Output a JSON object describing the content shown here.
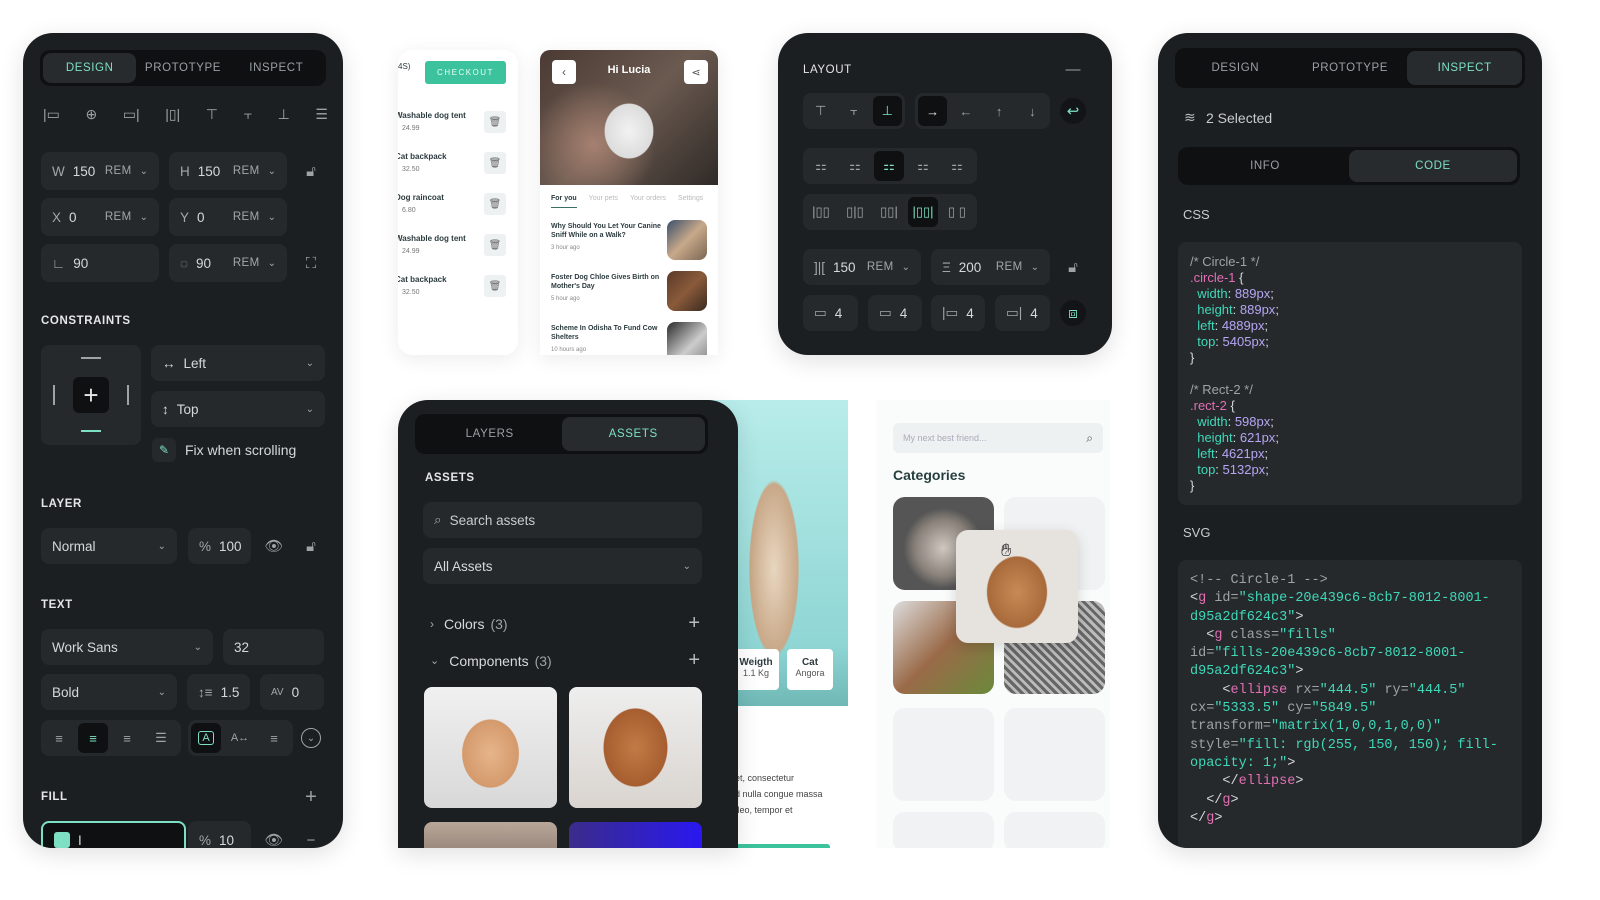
{
  "accent": "#7ee0c3",
  "design_panel": {
    "tabs": [
      "DESIGN",
      "PROTOTYPE",
      "INSPECT"
    ],
    "active_tab": "DESIGN",
    "align_icons": [
      "align-left-icon",
      "align-h-center-icon",
      "align-right-icon",
      "distribute-h-icon",
      "align-top-icon",
      "align-v-center-icon",
      "align-bottom-icon",
      "distribute-v-icon"
    ],
    "w": {
      "label": "W",
      "value": "150",
      "unit": "REM"
    },
    "h": {
      "label": "H",
      "value": "150",
      "unit": "REM"
    },
    "x": {
      "label": "X",
      "value": "0",
      "unit": "REM"
    },
    "y": {
      "label": "Y",
      "value": "0",
      "unit": "REM"
    },
    "rotation": {
      "value": "90"
    },
    "radius": {
      "value": "90",
      "unit": "REM"
    },
    "constraints": {
      "title": "CONSTRAINTS",
      "horizontal": "Left",
      "vertical": "Top",
      "fix_label": "Fix when scrolling"
    },
    "layer": {
      "title": "LAYER",
      "blend": "Normal",
      "opacity_sign": "%",
      "opacity": "100"
    },
    "text": {
      "title": "TEXT",
      "font": "Work Sans",
      "size": "32",
      "weight": "Bold",
      "line_height": "1.5",
      "letter_spacing": "0"
    },
    "fill": {
      "title": "FILL",
      "value": "I",
      "opacity_sign": "%",
      "opacity": "10",
      "swatch": "#7ee0c3"
    }
  },
  "cart_mock": {
    "checkout": "CHECKOUT",
    "header_fragment": "4S)",
    "items": [
      {
        "name": "Washable dog tent",
        "price": "24.99"
      },
      {
        "name": "Cat backpack",
        "price": "32.50"
      },
      {
        "name": "Dog raincoat",
        "price": "6.80"
      },
      {
        "name": "Washable dog tent",
        "price": "24.99"
      },
      {
        "name": "Cat backpack",
        "price": "32.50"
      }
    ]
  },
  "feed_mock": {
    "greeting": "Hi Lucia",
    "tabs": [
      "For you",
      "Your pets",
      "Your orders",
      "Settings"
    ],
    "articles": [
      {
        "title": "Why Should You Let Your Canine Sniff While on a Walk?",
        "time": "3 hour ago"
      },
      {
        "title": "Foster Dog Chloe Gives Birth on Mother's Day",
        "time": "5 hour ago"
      },
      {
        "title": "Scheme In Odisha To Fund Cow Shelters",
        "time": "10 hours ago"
      }
    ]
  },
  "layout_panel": {
    "title": "LAYOUT",
    "gap_h": {
      "value": "150",
      "unit": "REM"
    },
    "gap_v": {
      "value": "200",
      "unit": "REM"
    },
    "padding": [
      "4",
      "4",
      "4",
      "4"
    ]
  },
  "inspect_panel": {
    "tabs": [
      "DESIGN",
      "PROTOTYPE",
      "INSPECT"
    ],
    "active_tab": "INSPECT",
    "selected": "2 Selected",
    "subtabs": [
      "INFO",
      "CODE"
    ],
    "active_subtab": "CODE",
    "css_label": "CSS",
    "svg_label": "SVG",
    "css_lines": [
      [
        [
          "/* Circle-1 */",
          "com"
        ]
      ],
      [
        [
          ".circle-1",
          "sel"
        ],
        [
          " {",
          "p"
        ]
      ],
      [
        [
          "  width",
          "prop"
        ],
        [
          ": ",
          "p"
        ],
        [
          "889px",
          "val"
        ],
        [
          ";",
          "p"
        ]
      ],
      [
        [
          "  height",
          "prop"
        ],
        [
          ": ",
          "p"
        ],
        [
          "889px",
          "val"
        ],
        [
          ";",
          "p"
        ]
      ],
      [
        [
          "  left",
          "prop"
        ],
        [
          ": ",
          "p"
        ],
        [
          "4889px",
          "val"
        ],
        [
          ";",
          "p"
        ]
      ],
      [
        [
          "  top",
          "prop"
        ],
        [
          ": ",
          "p"
        ],
        [
          "5405px",
          "val"
        ],
        [
          ";",
          "p"
        ]
      ],
      [
        [
          "}",
          "p"
        ]
      ],
      [
        [
          "",
          "p"
        ]
      ],
      [
        [
          "/* Rect-2 */",
          "com"
        ]
      ],
      [
        [
          ".rect-2",
          "sel"
        ],
        [
          " {",
          "p"
        ]
      ],
      [
        [
          "  width",
          "prop"
        ],
        [
          ": ",
          "p"
        ],
        [
          "598px",
          "val"
        ],
        [
          ";",
          "p"
        ]
      ],
      [
        [
          "  height",
          "prop"
        ],
        [
          ": ",
          "p"
        ],
        [
          "621px",
          "val"
        ],
        [
          ";",
          "p"
        ]
      ],
      [
        [
          "  left",
          "prop"
        ],
        [
          ": ",
          "p"
        ],
        [
          "4621px",
          "val"
        ],
        [
          ";",
          "p"
        ]
      ],
      [
        [
          "  top",
          "prop"
        ],
        [
          ": ",
          "p"
        ],
        [
          "5132px",
          "val"
        ],
        [
          ";",
          "p"
        ]
      ],
      [
        [
          "}",
          "p"
        ]
      ]
    ],
    "svg_lines": [
      [
        [
          "<!-- Circle-1 -->",
          "com"
        ]
      ],
      [
        [
          "<",
          "p"
        ],
        [
          "g",
          "tag"
        ],
        [
          " id=",
          "com"
        ],
        [
          "\"shape-20e439c6-8cb7-8012-8001-",
          "str"
        ]
      ],
      [
        [
          "d95a2df624c3\"",
          "str"
        ],
        [
          ">",
          "p"
        ]
      ],
      [
        [
          "  <",
          "p"
        ],
        [
          "g",
          "tag"
        ],
        [
          " class=",
          "com"
        ],
        [
          "\"fills\"",
          "str"
        ]
      ],
      [
        [
          "id=",
          "com"
        ],
        [
          "\"fills-20e439c6-8cb7-8012-8001-",
          "str"
        ]
      ],
      [
        [
          "d95a2df624c3\"",
          "str"
        ],
        [
          ">",
          "p"
        ]
      ],
      [
        [
          "    <",
          "p"
        ],
        [
          "ellipse",
          "tag"
        ],
        [
          " rx=",
          "com"
        ],
        [
          "\"444.5\"",
          "str"
        ],
        [
          " ry=",
          "com"
        ],
        [
          "\"444.5\"",
          "str"
        ]
      ],
      [
        [
          "cx=",
          "com"
        ],
        [
          "\"5333.5\"",
          "str"
        ],
        [
          " cy=",
          "com"
        ],
        [
          "\"5849.5\"",
          "str"
        ]
      ],
      [
        [
          "transform=",
          "com"
        ],
        [
          "\"matrix(1,0,0,1,0,0)\"",
          "str"
        ]
      ],
      [
        [
          "style=",
          "com"
        ],
        [
          "\"fill: rgb(255, 150, 150); fill-",
          "str"
        ]
      ],
      [
        [
          "opacity: 1;\"",
          "str"
        ],
        [
          ">",
          "p"
        ]
      ],
      [
        [
          "    </",
          "p"
        ],
        [
          "ellipse",
          "tag"
        ],
        [
          ">",
          "p"
        ]
      ],
      [
        [
          "  </",
          "p"
        ],
        [
          "g",
          "tag"
        ],
        [
          ">",
          "p"
        ]
      ],
      [
        [
          "</",
          "p"
        ],
        [
          "g",
          "tag"
        ],
        [
          ">",
          "p"
        ]
      ]
    ]
  },
  "assets_panel": {
    "tabs": [
      "LAYERS",
      "ASSETS"
    ],
    "active_tab": "ASSETS",
    "title": "ASSETS",
    "search_placeholder": "Search assets",
    "filter": "All Assets",
    "groups": [
      {
        "name": "Colors",
        "count": "(3)",
        "expanded": false
      },
      {
        "name": "Components",
        "count": "(3)",
        "expanded": true
      }
    ]
  },
  "pet_mock": {
    "stats": [
      {
        "label": "Weigth",
        "value": "1.1 Kg"
      },
      {
        "label": "Cat",
        "value": "Angora"
      }
    ],
    "body_lines": [
      "net, consectetur",
      "ed nulla congue massa",
      "h leo, tempor et"
    ]
  },
  "categories_mock": {
    "search_placeholder": "My next best friend...",
    "title": "Categories"
  }
}
